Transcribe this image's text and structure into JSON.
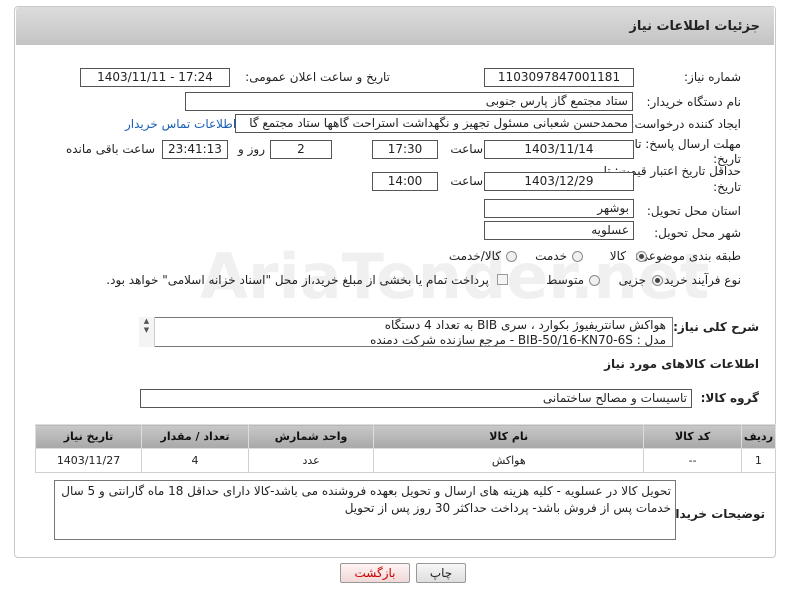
{
  "header": {
    "title": "جزئیات اطلاعات نیاز"
  },
  "form": {
    "need_number_label": "شماره نیاز:",
    "need_number": "1103097847001181",
    "announce_label": "تاریخ و ساعت اعلان عمومی:",
    "announce_value": "1403/11/11 - 17:24",
    "buyer_label": "نام دستگاه خریدار:",
    "buyer_value": "ستاد مجتمع گاز پارس جنوبی",
    "creator_label": "ایجاد کننده درخواست:",
    "creator_value": "محمدحسن شعبانی مسئول تجهیز و نگهداشت استراحت گاهها ستاد مجتمع گا",
    "contact_link": "اطلاعات تماس خریدار",
    "reply_label": "مهلت ارسال پاسخ: تا",
    "reply_label2": "تاریخ:",
    "reply_date": "1403/11/14",
    "time_label": "ساعت",
    "reply_time": "17:30",
    "days_value": "2",
    "days_label": "روز و",
    "remaining_value": "23:41:13",
    "remaining_label": "ساعت باقی مانده",
    "validity_label": "حداقل تاریخ اعتبار قیمت: تا",
    "validity_label2": "تاریخ:",
    "validity_date": "1403/12/29",
    "validity_time": "14:00",
    "province_label": "استان محل تحویل:",
    "province_value": "بوشهر",
    "city_label": "شهر محل تحویل:",
    "city_value": "عسلویه",
    "category_label": "طبقه بندی موضوعی:",
    "category_options": [
      "کالا",
      "خدمت",
      "کالا/خدمت"
    ],
    "purchase_label": "نوع فرآیند خرید :",
    "purchase_options": [
      "جزیی",
      "متوسط"
    ],
    "payment_text": "پرداخت تمام یا بخشی از مبلغ خرید،از محل \"اسناد خزانه اسلامی\" خواهد بود."
  },
  "description": {
    "label": "شرح کلی نیاز:",
    "line1": "هواکش سانتریفیوژ بکوارد ، سری BIB به تعداد 4 دستگاه",
    "line2": "مدل :  BIB-50/16-KN70-6S   - مرجع سازنده شرکت دمنده"
  },
  "goods_section": {
    "title": "اطلاعات کالاهای مورد نیاز",
    "group_label": "گروه کالا:",
    "group_value": "تاسیسات و مصالح ساختمانی"
  },
  "table": {
    "headers": [
      "ردیف",
      "کد کالا",
      "نام کالا",
      "واحد شمارش",
      "تعداد / مقدار",
      "تاریخ نیاز"
    ],
    "rows": [
      [
        "1",
        "--",
        "هواکش",
        "عدد",
        "4",
        "1403/11/27"
      ]
    ]
  },
  "buyer_notes": {
    "label": "توضیحات خریدار:",
    "text": "تحویل کالا در عسلویه - کلیه هزینه های ارسال و تحویل بعهده فروشنده می باشد-کالا دارای حداقل 18 ماه گارانتی و 5 سال خدمات پس از فروش باشد- پرداخت حداکثر 30 روز پس از تحویل"
  },
  "buttons": {
    "print": "چاپ",
    "back": "بازگشت"
  },
  "watermark": "AriaTender.net"
}
